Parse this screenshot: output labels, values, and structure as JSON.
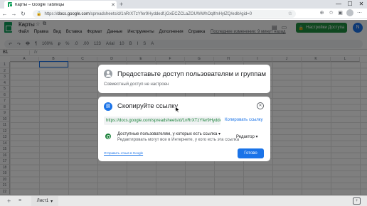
{
  "browser": {
    "tab_title": "Карты – Google Таблицы",
    "tab_close": "✕",
    "new_tab": "+",
    "window_controls": [
      "—",
      "☐",
      "✕"
    ],
    "url_host": "docs.google.com",
    "url_rest": "/spreadsheets/d/1nRrXTzYfer9Hyddedf.jGxECZCLaZOUWWhOqlfmHylZQ/edit#gid=0",
    "url_prefix": "https://"
  },
  "sheets": {
    "title": "Карты",
    "menu": [
      "Файл",
      "Правка",
      "Вид",
      "Вставка",
      "Формат",
      "Данные",
      "Инструменты",
      "Дополнения",
      "Справка"
    ],
    "last_edit": "Последнее изменение: 9 минут назад",
    "access_button": "Настройки Доступа",
    "avatar_letter": "N",
    "cell_ref": "B1",
    "fx": "fx",
    "columns": [
      "A",
      "B",
      "C",
      "D",
      "E",
      "F",
      "G",
      "H",
      "I",
      "J",
      "K",
      "L"
    ],
    "rows": [
      "1",
      "2",
      "3",
      "4",
      "5",
      "6",
      "7",
      "8",
      "9",
      "10",
      "11",
      "12",
      "13",
      "14",
      "15",
      "16",
      "17",
      "18",
      "19",
      "20",
      "21",
      "22"
    ],
    "toolbar": [
      "↶",
      "↷",
      "🖶",
      "¶",
      "100%",
      "₽",
      "%",
      ".0",
      ".00",
      "123",
      "Arial",
      "10",
      "B",
      "I",
      "S",
      "A"
    ]
  },
  "dialog_access": {
    "title": "Предоставьте доступ пользователям и группам",
    "subtitle": "Совместный доступ не настроен"
  },
  "dialog_link": {
    "title": "Скопируйте ссылку",
    "link": "https://docs.google.com/spreadsheets/d/1nRrXTzYfer9Hyddedf...",
    "copy_link": "Копировать ссылку",
    "access_label": "Доступные пользователям, у которых есть ссылка",
    "access_desc": "Редактировать могут все в Интернете, у кого есть эта ссылка",
    "role": "Редактор",
    "feedback": "Отправить отзыв в Google",
    "done": "Готово",
    "close": "✕"
  },
  "bottom": {
    "add": "+",
    "list": "≡",
    "sheet_tab": "Лист1"
  },
  "colors": {
    "accent": "#1a73e8",
    "sheets_green": "#0f9d58",
    "access_green": "#1e8e3e"
  }
}
